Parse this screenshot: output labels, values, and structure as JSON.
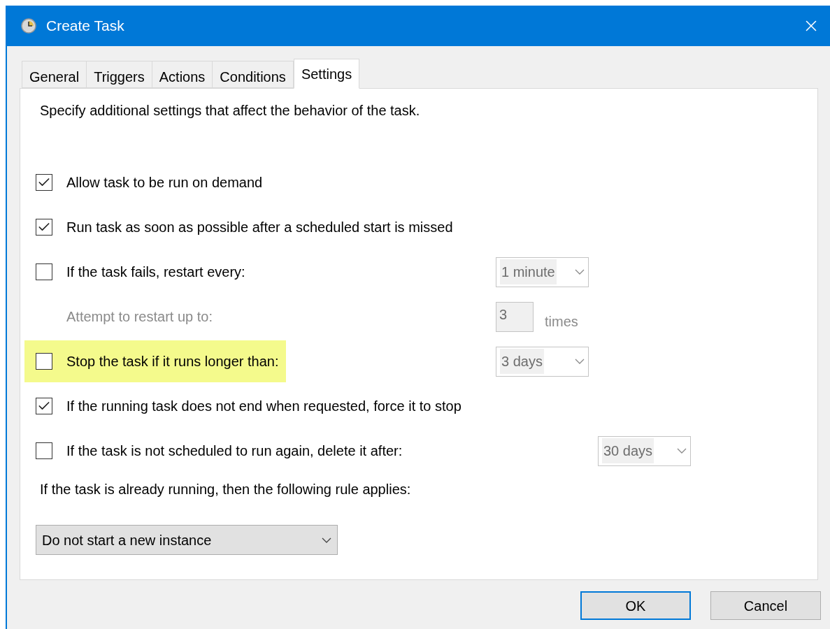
{
  "window": {
    "title": "Create Task"
  },
  "tabs": [
    {
      "label": "General",
      "selected": false
    },
    {
      "label": "Triggers",
      "selected": false
    },
    {
      "label": "Actions",
      "selected": false
    },
    {
      "label": "Conditions",
      "selected": false
    },
    {
      "label": "Settings",
      "selected": true
    }
  ],
  "description": "Specify additional settings that affect the behavior of the task.",
  "rows": [
    {
      "kind": "checkbox",
      "label": "Allow task to be run on demand",
      "checked": true,
      "highlighted": false
    },
    {
      "kind": "checkbox",
      "label": "Run task as soon as possible after a scheduled start is missed",
      "checked": true,
      "highlighted": false
    },
    {
      "kind": "checkbox",
      "label": "If the task fails, restart every:",
      "checked": false,
      "highlighted": false,
      "control": {
        "kind": "dropdown",
        "value": "1 minute",
        "disabled": true
      }
    },
    {
      "kind": "label",
      "label": "Attempt to restart up to:",
      "disabled": true,
      "highlighted": false,
      "control": {
        "kind": "number",
        "value": "3",
        "suffix": "times",
        "disabled": true
      }
    },
    {
      "kind": "checkbox",
      "label": "Stop the task if it runs longer than:",
      "checked": false,
      "highlighted": true,
      "control": {
        "kind": "dropdown",
        "value": "3 days",
        "disabled": true
      }
    },
    {
      "kind": "checkbox",
      "label": "If the running task does not end when requested, force it to stop",
      "checked": true,
      "highlighted": false
    },
    {
      "kind": "checkbox",
      "label": "If the task is not scheduled to run again, delete it after:",
      "checked": false,
      "highlighted": false,
      "control": {
        "kind": "dropdown",
        "value": "30 days",
        "disabled": true
      }
    }
  ],
  "rule": {
    "label": "If the task is already running, then the following rule applies:",
    "dropdown": {
      "value": "Do not start a new instance"
    }
  },
  "buttons": [
    {
      "label": "OK",
      "default": true
    },
    {
      "label": "Cancel",
      "default": false
    }
  ]
}
